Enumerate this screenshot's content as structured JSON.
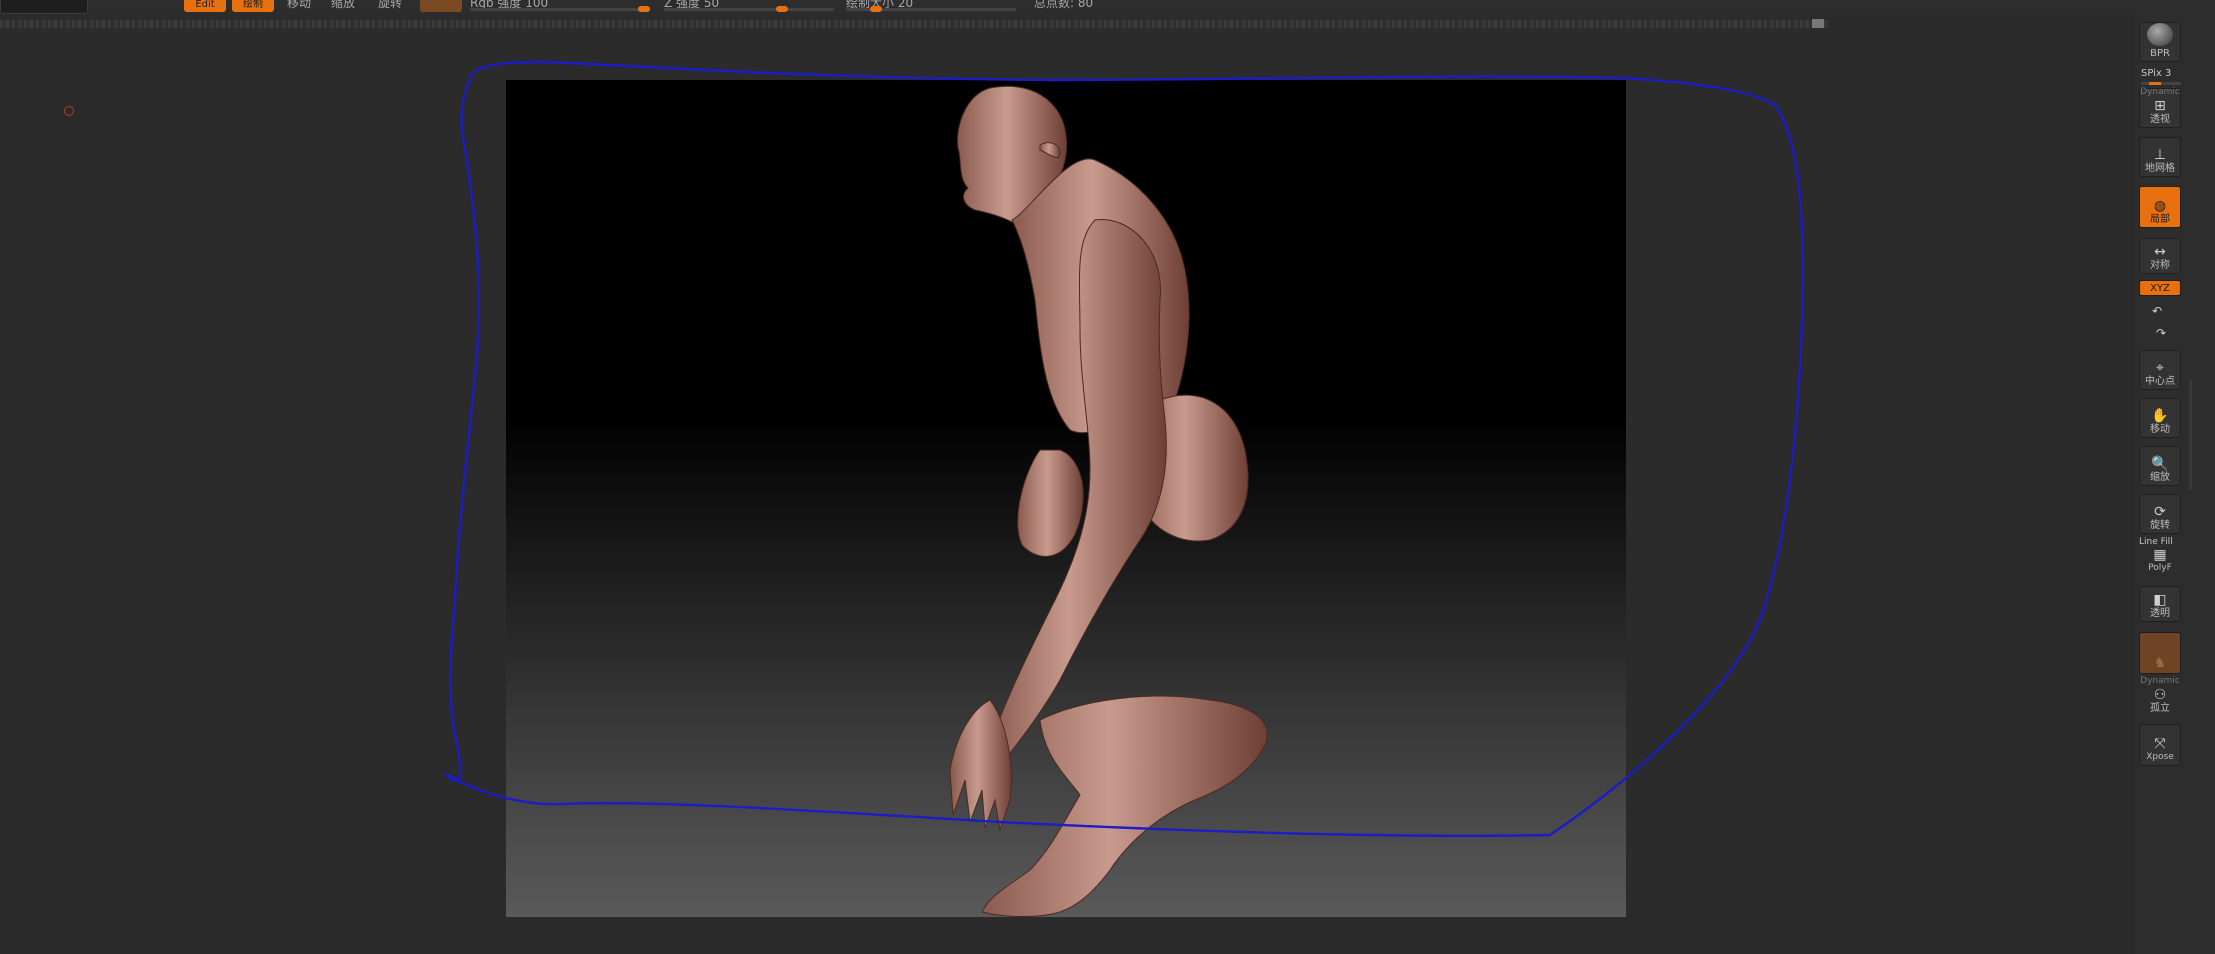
{
  "toolbar": {
    "orange_btn_1": "Edit",
    "orange_btn_2": "绘制",
    "text_1": "移动",
    "text_2": "缩放",
    "text_3": "旋转",
    "rgb_label": "Rgb 强度 100",
    "z_label": "Z 强度 50",
    "draw_size_label": "绘制大小 20",
    "active_points_label": "总点数: 80"
  },
  "shelf": {
    "bpr": "BPR",
    "spix": "SPix 3",
    "dynamic": "Dynamic",
    "persp": "透视",
    "floor": "地网格",
    "local": "局部",
    "sym": "对称",
    "xyz": "XYZ",
    "center": "中心点",
    "move": "移动",
    "scale": "缩放",
    "rotate": "旋转",
    "linefill": "Line Fill",
    "polyf": "PolyF",
    "transp": "透明",
    "dynamic2": "Dynamic",
    "solo": "孤立",
    "xpose": "Xpose"
  },
  "colors": {
    "accent": "#e8700f",
    "annotation_stroke": "#1c1cc8",
    "marker": "#c0392b"
  }
}
